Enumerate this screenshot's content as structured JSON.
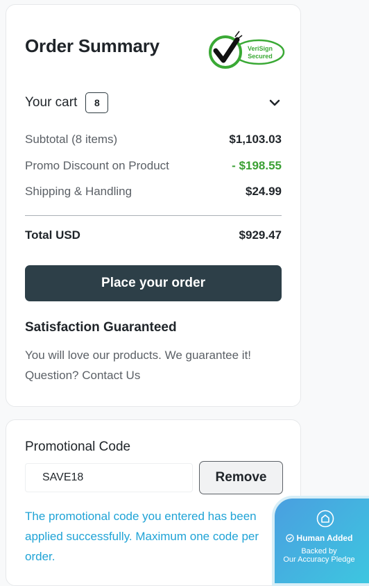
{
  "summary": {
    "title": "Order Summary",
    "verisign_line1": "VeriSign",
    "verisign_line2": "Secured",
    "cart_label": "Your cart",
    "cart_count": "8",
    "lines": [
      {
        "label": "Subtotal (8 items)",
        "value": "$1,103.03"
      },
      {
        "label": "Promo Discount on Product",
        "value": "- $198.55"
      },
      {
        "label": "Shipping & Handling",
        "value": "$24.99"
      }
    ],
    "total_label": "Total USD",
    "total_value": "$929.47",
    "place_order": "Place your order",
    "satisfaction_title": "Satisfaction Guaranteed",
    "satisfaction_text": "You will love our products. We guarantee it!",
    "question_text": "Question?",
    "contact_link": "Contact Us",
    "colors": {
      "accent_dark": "#2d3f48",
      "discount_green": "#3ba034",
      "verisign_green": "#3aa935"
    }
  },
  "promo": {
    "title": "Promotional Code",
    "code_value": "SAVE18",
    "remove_label": "Remove",
    "message": "The promotional code you entered has been applied successfully. Maximum one code per order.",
    "message_color": "#1fa3d6"
  },
  "badge": {
    "line1": "Human Added",
    "line2": "Backed by",
    "line3": "Our Accuracy Pledge"
  },
  "icons": [
    "verisign-checkmark-icon",
    "chevron-down-icon",
    "shield-badge-icon",
    "check-circle-icon"
  ]
}
